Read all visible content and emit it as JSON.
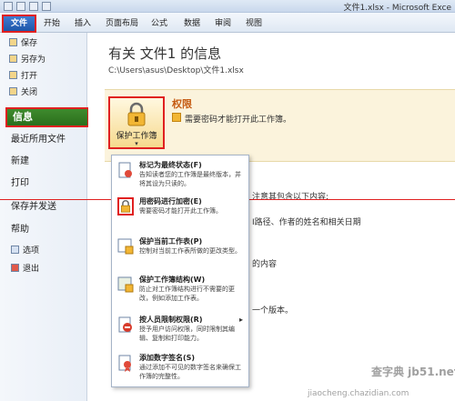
{
  "window": {
    "title": "文件1.xlsx - Microsoft Exce"
  },
  "tabs": [
    "文件",
    "开始",
    "插入",
    "页面布局",
    "公式",
    "数据",
    "审阅",
    "视图"
  ],
  "nav": {
    "small_items": [
      "保存",
      "另存为",
      "打开",
      "关闭"
    ],
    "active": "信息",
    "big_items": [
      "最近所用文件",
      "新建",
      "打印",
      "保存并发送",
      "帮助"
    ],
    "bottom_items": [
      "选项",
      "退出"
    ]
  },
  "main": {
    "title": "有关 文件1 的信息",
    "path": "C:\\Users\\asus\\Desktop\\文件1.xlsx",
    "protect_button": "保护工作簿",
    "permission_title": "权限",
    "permission_desc": "需要密码才能打开此工作簿。",
    "side_texts": [
      "注意其包含以下内容:",
      "I路径、作者的姓名和相关日期",
      "的内容",
      "一个版本。"
    ]
  },
  "dropdown": [
    {
      "title": "标记为最终状态(F)",
      "desc": "告知读者您的工作簿是最终版本，并将其设为只读的。",
      "icon": "final-icon"
    },
    {
      "title": "用密码进行加密(E)",
      "desc": "需要密码才能打开此工作簿。",
      "icon": "lock-key-icon"
    },
    {
      "title": "保护当前工作表(P)",
      "desc": "控制对当前工作表所做的更改类型。",
      "icon": "sheet-lock-icon"
    },
    {
      "title": "保护工作簿结构(W)",
      "desc": "防止对工作簿结构进行不需要的更改，例如添加工作表。",
      "icon": "workbook-lock-icon"
    },
    {
      "title": "按人员限制权限(R)",
      "desc": "授予用户访问权限，同时限制其编辑、复制和打印能力。",
      "icon": "restrict-icon"
    },
    {
      "title": "添加数字签名(S)",
      "desc": "通过添加不可见的数字签名来确保工作簿的完整性。",
      "icon": "signature-icon"
    }
  ],
  "watermark": {
    "line1": "查字典 jb51.net",
    "line2": "jiaocheng.chazidian.com"
  }
}
